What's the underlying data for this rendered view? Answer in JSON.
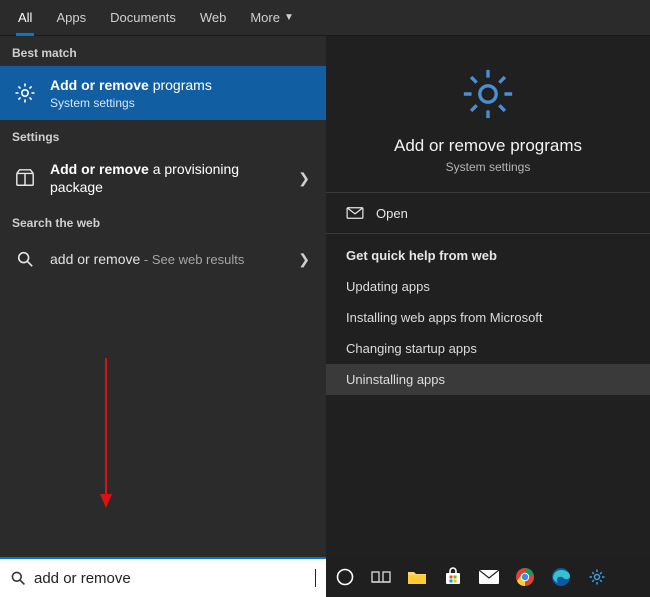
{
  "tabs": {
    "all": "All",
    "apps": "Apps",
    "documents": "Documents",
    "web": "Web",
    "more": "More"
  },
  "left": {
    "best_match": "Best match",
    "result_main": {
      "title_bold": "Add or remove",
      "title_rest": " programs",
      "subtitle": "System settings"
    },
    "settings_label": "Settings",
    "settings_item": {
      "title_bold": "Add or remove",
      "title_rest": " a provisioning package"
    },
    "search_web_label": "Search the web",
    "web_item": {
      "query": "add or remove",
      "suffix": " - See web results"
    }
  },
  "right": {
    "hero_title": "Add or remove programs",
    "hero_sub": "System settings",
    "open": "Open",
    "help_header": "Get quick help from web",
    "help_items": {
      "h0": "Updating apps",
      "h1": "Installing web apps from Microsoft",
      "h2": "Changing startup apps",
      "h3": "Uninstalling apps"
    }
  },
  "search": {
    "value": "add or remove"
  }
}
